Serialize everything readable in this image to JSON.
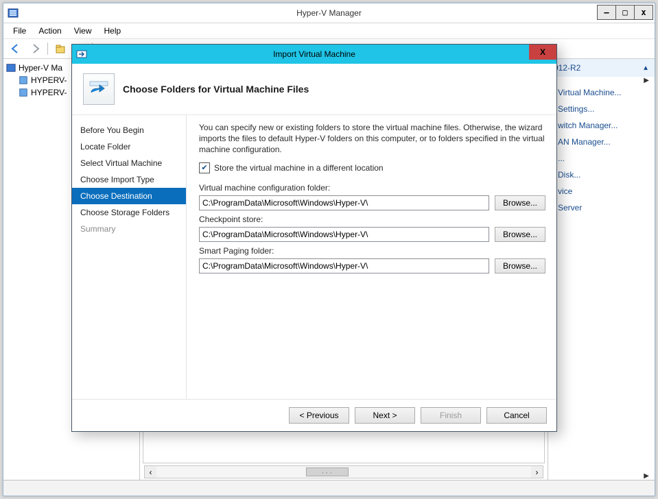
{
  "app": {
    "title": "Hyper-V Manager"
  },
  "menubar": [
    "File",
    "Action",
    "View",
    "Help"
  ],
  "tree": {
    "root": "Hyper-V Ma",
    "children": [
      "HYPERV-",
      "HYPERV-"
    ]
  },
  "actions": {
    "heading": "012-R2",
    "items": [
      "Virtual Machine...",
      "Settings...",
      "witch Manager...",
      "AN Manager...",
      "...",
      "Disk...",
      "vice",
      "Server"
    ]
  },
  "dialog": {
    "window_title": "Import Virtual Machine",
    "header_title": "Choose Folders for Virtual Machine Files",
    "close_label": "X",
    "nav": [
      {
        "label": "Before You Begin",
        "state": "normal"
      },
      {
        "label": "Locate Folder",
        "state": "normal"
      },
      {
        "label": "Select Virtual Machine",
        "state": "normal"
      },
      {
        "label": "Choose Import Type",
        "state": "normal"
      },
      {
        "label": "Choose Destination",
        "state": "selected"
      },
      {
        "label": "Choose Storage Folders",
        "state": "normal"
      },
      {
        "label": "Summary",
        "state": "disabled"
      }
    ],
    "description": "You can specify new or existing folders to store the virtual machine files. Otherwise, the wizard imports the files to default Hyper-V folders on this computer, or to folders specified in the virtual machine configuration.",
    "checkbox_label": "Store the virtual machine in a different location",
    "checkbox_checked": true,
    "fields": [
      {
        "label": "Virtual machine configuration folder:",
        "value": "C:\\ProgramData\\Microsoft\\Windows\\Hyper-V\\",
        "browse": "Browse..."
      },
      {
        "label": "Checkpoint store:",
        "value": "C:\\ProgramData\\Microsoft\\Windows\\Hyper-V\\",
        "browse": "Browse..."
      },
      {
        "label": "Smart Paging folder:",
        "value": "C:\\ProgramData\\Microsoft\\Windows\\Hyper-V\\",
        "browse": "Browse..."
      }
    ],
    "buttons": {
      "previous": "< Previous",
      "next": "Next >",
      "finish": "Finish",
      "cancel": "Cancel"
    }
  },
  "labels": {
    "minimize": "–",
    "maximize": "□",
    "close": "x"
  }
}
